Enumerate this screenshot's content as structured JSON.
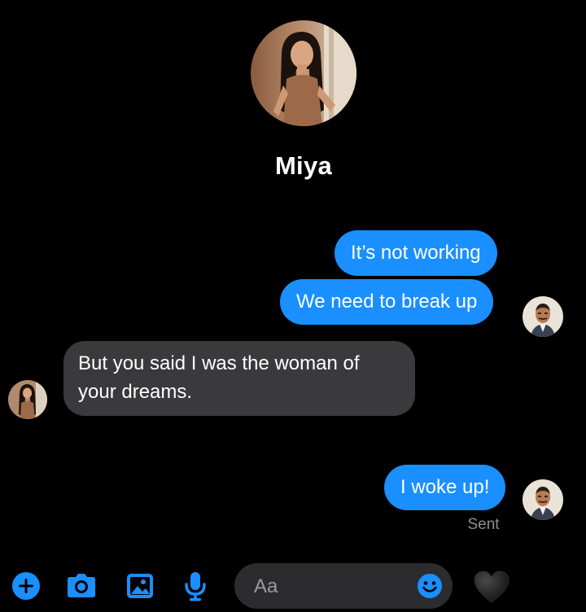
{
  "contact": {
    "name": "Miya"
  },
  "messages": [
    {
      "direction": "outgoing",
      "text": "It’s not working"
    },
    {
      "direction": "outgoing",
      "text": "We need to break up"
    },
    {
      "direction": "incoming",
      "text": "But you said I was the woman of your dreams."
    },
    {
      "direction": "outgoing",
      "text": "I woke up!"
    }
  ],
  "status": {
    "sent": "Sent"
  },
  "composer": {
    "placeholder": "Aa"
  },
  "toolbar": {
    "icons": [
      "plus-icon",
      "camera-icon",
      "image-icon",
      "microphone-icon",
      "emoji-icon",
      "heart-icon"
    ]
  },
  "colors": {
    "background": "#000000",
    "outgoing_bubble": "#1a8fff",
    "incoming_bubble": "#3a3a3c",
    "accent": "#1a8fff",
    "heart": "#1c1c1c"
  }
}
